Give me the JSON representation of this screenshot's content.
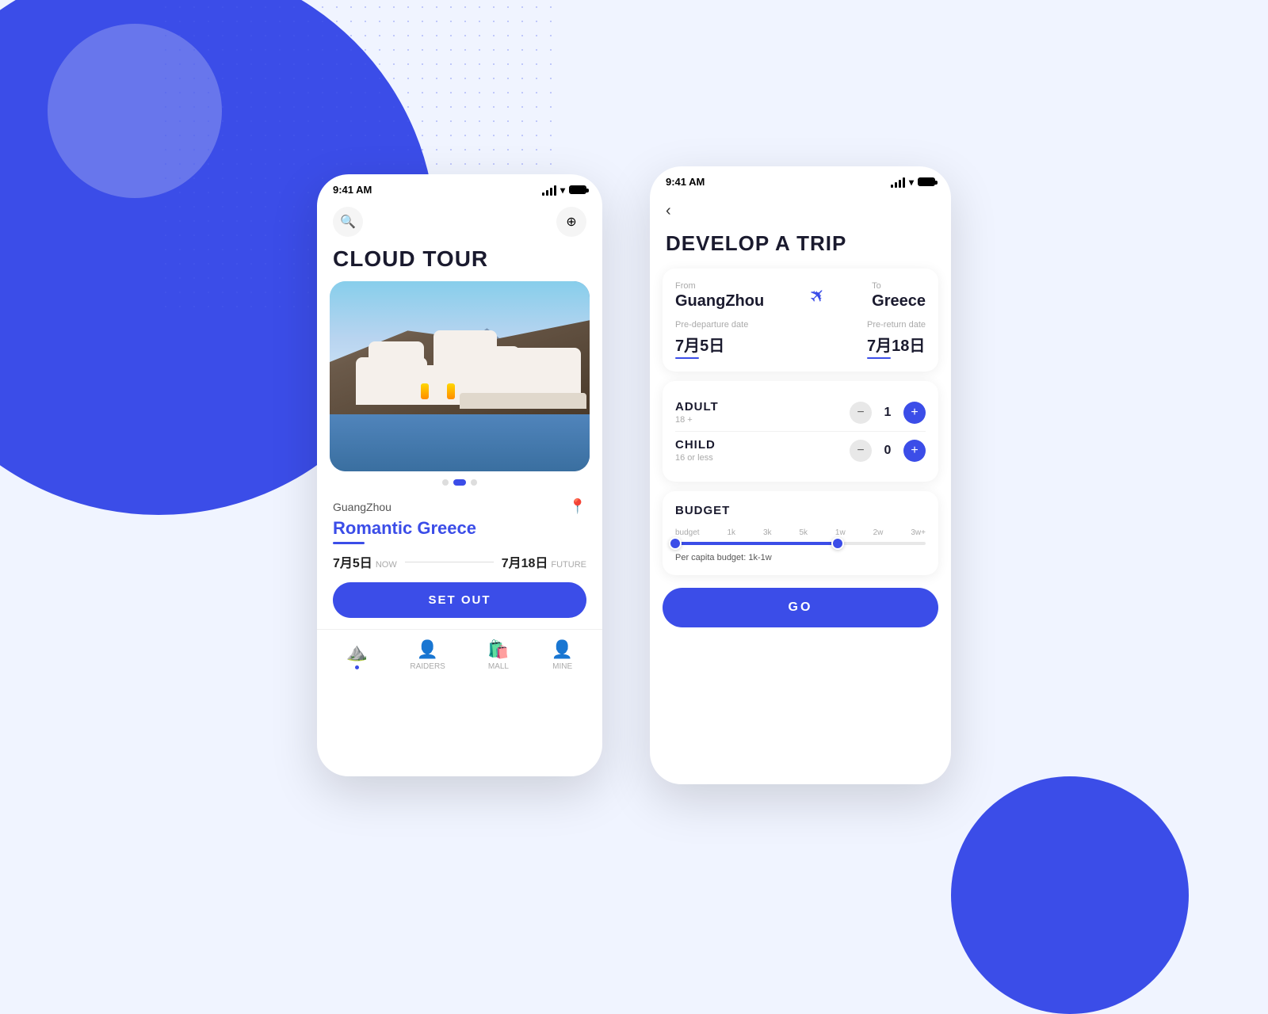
{
  "background": {
    "primary_color": "#3b4de8",
    "light_color": "#f0f4ff"
  },
  "phone1": {
    "status_bar": {
      "time": "9:41 AM"
    },
    "title": "CLOUD TOUR",
    "location": "GuangZhou",
    "trip_name": "Romantic Greece",
    "date_start": "7月5日",
    "date_start_label": "NOW",
    "date_end": "7月18日",
    "date_end_label": "FUTURE",
    "set_out_btn": "SET OUT",
    "nav": {
      "items": [
        {
          "label": "",
          "icon": "home",
          "active": true
        },
        {
          "label": "RAIDERS",
          "icon": "raiders",
          "active": false
        },
        {
          "label": "MALL",
          "icon": "mall",
          "active": false
        },
        {
          "label": "MINE",
          "icon": "mine",
          "active": false
        }
      ]
    }
  },
  "phone2": {
    "status_bar": {
      "time": "9:41 AM"
    },
    "title": "DEVELOP A TRIP",
    "from_label": "From",
    "from_city": "GuangZhou",
    "to_label": "To",
    "to_city": "Greece",
    "pre_departure_label": "Pre-departure date",
    "pre_return_label": "Pre-return date",
    "departure_date": "7月5日",
    "return_date": "7月18日",
    "adult_label": "ADULT",
    "adult_age": "18 +",
    "adult_count": "1",
    "child_label": "CHILD",
    "child_age": "16 or less",
    "child_count": "0",
    "budget_label": "BUDGET",
    "budget_scale": [
      "budget",
      "1k",
      "3k",
      "5k",
      "1w",
      "2w",
      "3w+"
    ],
    "budget_info": "Per capita budget: 1k-1w",
    "go_btn": "GO"
  }
}
